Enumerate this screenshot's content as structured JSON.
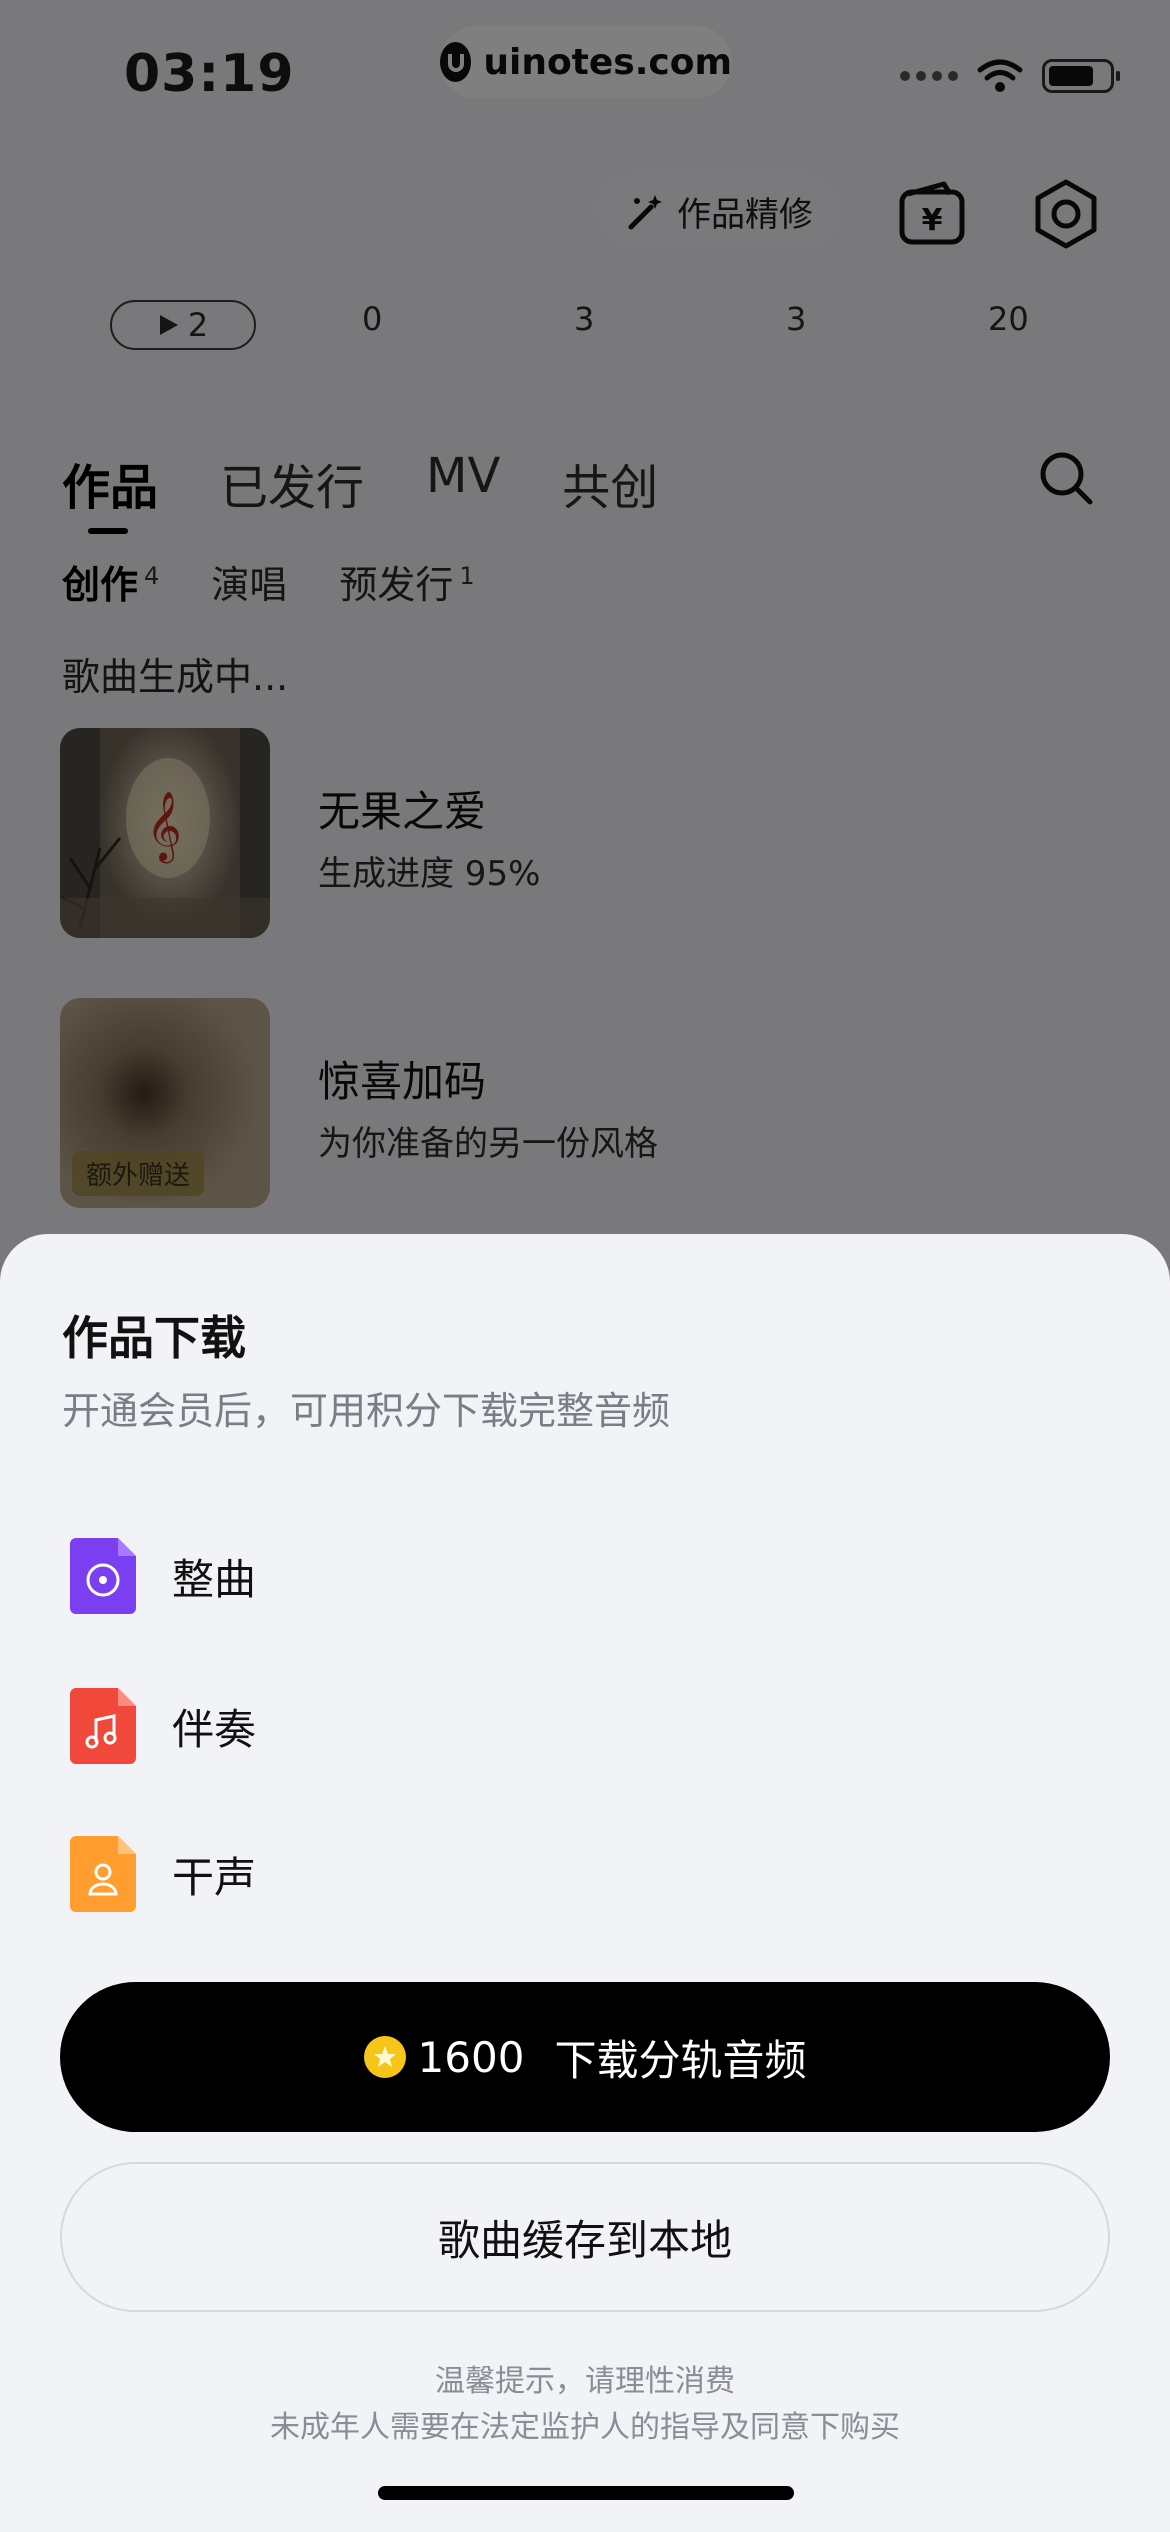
{
  "status_bar": {
    "time": "03:19",
    "watermark": "uinotes.com"
  },
  "header": {
    "refine_label": "作品精修",
    "icons": {
      "wallet": "wallet-yen-icon",
      "settings": "settings-icon"
    }
  },
  "stats": {
    "plays": "2",
    "values": [
      "0",
      "3",
      "3",
      "20"
    ]
  },
  "tabs": [
    "作品",
    "已发行",
    "MV",
    "共创"
  ],
  "subtabs": [
    {
      "label": "创作",
      "count": "4"
    },
    {
      "label": "演唱",
      "count": ""
    },
    {
      "label": "预发行",
      "count": "1"
    }
  ],
  "generating_header": "歌曲生成中...",
  "songs": [
    {
      "title": "无果之爱",
      "subtitle": "生成进度 95%",
      "progress": 0.95
    },
    {
      "title": "惊喜加码",
      "subtitle": "为你准备的另一份风格",
      "badge": "额外赠送"
    }
  ],
  "sheet": {
    "title": "作品下载",
    "subtitle": "开通会员后，可用积分下载完整音频",
    "options": [
      {
        "label": "整曲",
        "icon": "disc-file-icon",
        "color": "#7b3ff2"
      },
      {
        "label": "伴奏",
        "icon": "music-file-icon",
        "color": "#f0483a"
      },
      {
        "label": "干声",
        "icon": "vocal-file-icon",
        "color": "#ff9d2e"
      }
    ],
    "primary_points": "1600",
    "primary_label": "下载分轨音频",
    "secondary_label": "歌曲缓存到本地",
    "tip1": "温馨提示，请理性消费",
    "tip2": "未成年人需要在法定监护人的指导及同意下购买"
  }
}
